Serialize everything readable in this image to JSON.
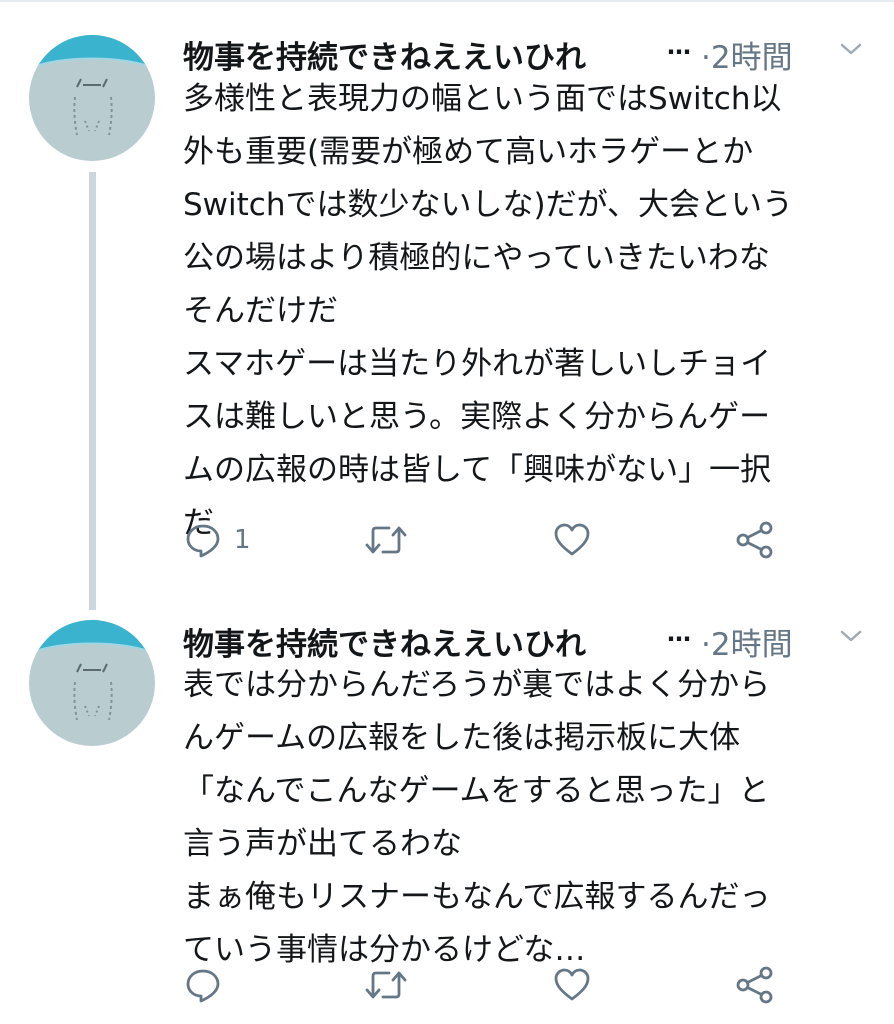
{
  "tweets": [
    {
      "author": "物事を持続できねええいひれ",
      "ellipsis": "…",
      "time": "·2時間",
      "lines": [
        "多様性と表現力の幅という面ではSwitch以",
        "外も重要(需要が極めて高いホラゲーとか",
        "Switchでは数少ないしな)だが、大会という",
        "公の場はより積極的にやっていきたいわな",
        "そんだけだ",
        "スマホゲーは当たり外れが著しいしチョイ",
        "スは難しいと思う。実際よく分からんゲー",
        "ムの広報の時は皆して「興味がない」一択",
        "だ"
      ],
      "reply_count": "1",
      "retweet_count": "",
      "like_count": ""
    },
    {
      "author": "物事を持続できねええいひれ",
      "ellipsis": "…",
      "time": "·2時間",
      "lines": [
        "表では分からんだろうが裏ではよく分から",
        "んゲームの広報をした後は掲示板に大体",
        "「なんでこんなゲームをすると思った」と",
        "言う声が出てるわな",
        "まぁ俺もリスナーもなんで広報するんだっ",
        "ていう事情は分かるけどな…"
      ],
      "reply_count": "",
      "retweet_count": "",
      "like_count": ""
    }
  ],
  "icons": [
    "reply-icon",
    "retweet-icon",
    "like-icon",
    "share-icon",
    "chevron-down-icon"
  ],
  "colors": {
    "text": "#14171a",
    "muted": "#657786",
    "thread_line": "#ccd6dd",
    "avatar_bg": "#b9cdd1",
    "avatar_cap": "#3ab3cf"
  }
}
